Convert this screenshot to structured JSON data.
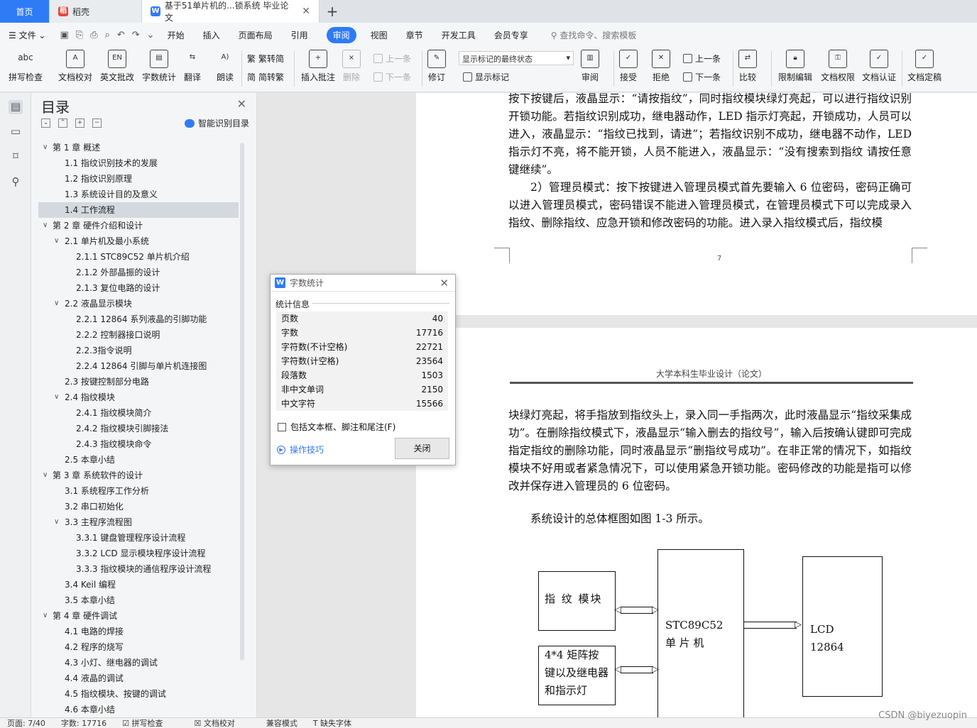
{
  "tabs": {
    "home": "首页",
    "daoke": "稻壳",
    "doc": "基于51单片机的...锁系统 毕业论文"
  },
  "menu": {
    "file": "文件",
    "items": [
      "开始",
      "插入",
      "页面布局",
      "引用",
      "审阅",
      "视图",
      "章节",
      "开发工具",
      "会员专享"
    ],
    "active": "审阅",
    "search": "查找命令、搜索模板"
  },
  "ribbon": {
    "spell": "拼写检查",
    "doccheck": "文档校对",
    "engcheck": "英文批改",
    "wordcount": "字数统计",
    "translate": "翻译",
    "read": "朗读",
    "trad": "繁转简",
    "simp": "简转繁",
    "insertcomment": "插入批注",
    "delete": "删除",
    "prev": "上一条",
    "next": "下一条",
    "revise": "修订",
    "markstate": "显示标记的最终状态",
    "showmark": "显示标记",
    "review": "审阅",
    "accept": "接受",
    "reject": "拒绝",
    "prev2": "上一条",
    "next2": "下一条",
    "compare": "比较",
    "restrict": "限制编辑",
    "rights": "文档权限",
    "auth": "文档认证",
    "final": "文档定稿"
  },
  "toc": {
    "title": "目录",
    "smart": "智能识别目录",
    "items": [
      {
        "t": "第 1 章  概述",
        "lv": 1,
        "arr": "﹀"
      },
      {
        "t": "1.1  指纹识别技术的发展",
        "lv": 2
      },
      {
        "t": "1.2  指纹识别原理",
        "lv": 2
      },
      {
        "t": "1.3  系统设计目的及意义",
        "lv": 2
      },
      {
        "t": "1.4  工作流程",
        "lv": 2,
        "sel": true
      },
      {
        "t": "第 2 章  硬件介绍和设计",
        "lv": 1,
        "arr": "﹀"
      },
      {
        "t": "2.1  单片机及最小系统",
        "lv": 2,
        "arr": "﹀"
      },
      {
        "t": "2.1.1 STC89C52 单片机介绍",
        "lv": 3
      },
      {
        "t": "2.1.2  外部晶振的设计",
        "lv": 3
      },
      {
        "t": "2.1.3  复位电路的设计",
        "lv": 3
      },
      {
        "t": "2.2  液晶显示模块",
        "lv": 2,
        "arr": "﹀"
      },
      {
        "t": "2.2.1 12864 系列液晶的引脚功能",
        "lv": 3
      },
      {
        "t": "2.2.2  控制器接口说明",
        "lv": 3
      },
      {
        "t": "2.2.3指令说明",
        "lv": 3
      },
      {
        "t": "2.2.4 12864 引脚与单片机连接图",
        "lv": 3
      },
      {
        "t": "2.3  按键控制部分电路",
        "lv": 2
      },
      {
        "t": "2.4  指纹模块",
        "lv": 2,
        "arr": "﹀"
      },
      {
        "t": "2.4.1  指纹模块简介",
        "lv": 3
      },
      {
        "t": "2.4.2  指纹模块引脚接法",
        "lv": 3
      },
      {
        "t": "2.4.3  指纹模块命令",
        "lv": 3
      },
      {
        "t": "2.5  本章小结",
        "lv": 2
      },
      {
        "t": "第 3 章  系统软件的设计",
        "lv": 1,
        "arr": "﹀"
      },
      {
        "t": "3.1  系统程序工作分析",
        "lv": 2
      },
      {
        "t": "3.2  串口初始化",
        "lv": 2
      },
      {
        "t": "3.3  主程序流程图",
        "lv": 2,
        "arr": "﹀"
      },
      {
        "t": "3.3.1  键盘管理程序设计流程",
        "lv": 3
      },
      {
        "t": "3.3.2 LCD 显示模块程序设计流程",
        "lv": 3
      },
      {
        "t": "3.3.3  指纹模块的通信程序设计流程",
        "lv": 3
      },
      {
        "t": "3.4 Keil 编程",
        "lv": 2
      },
      {
        "t": "3.5  本章小结",
        "lv": 2
      },
      {
        "t": "第 4 章  硬件调试",
        "lv": 1,
        "arr": "﹀"
      },
      {
        "t": "4.1  电路的焊接",
        "lv": 2
      },
      {
        "t": "4.2  程序的烧写",
        "lv": 2
      },
      {
        "t": "4.3  小灯、继电器的调试",
        "lv": 2
      },
      {
        "t": "4.4  液晶的调试",
        "lv": 2
      },
      {
        "t": "4.5  指纹模块、按键的调试",
        "lv": 2
      },
      {
        "t": "4.6  本章小结",
        "lv": 2
      }
    ]
  },
  "dialog": {
    "title": "字数统计",
    "section": "统计信息",
    "rows": [
      {
        "k": "页数",
        "v": "40"
      },
      {
        "k": "字数",
        "v": "17716"
      },
      {
        "k": "字符数(不计空格)",
        "v": "22721"
      },
      {
        "k": "字符数(计空格)",
        "v": "23564"
      },
      {
        "k": "段落数",
        "v": "1503"
      },
      {
        "k": "非中文单词",
        "v": "2150"
      },
      {
        "k": "中文字符",
        "v": "15566"
      }
    ],
    "checkbox": "包括文本框、脚注和尾注(F)",
    "tips": "操作技巧",
    "close": "关闭"
  },
  "page1": {
    "text": "按下按键后，液晶显示：“请按指纹”，同时指纹模块绿灯亮起，可以进行指纹识别开锁功能。若指纹识别成功，继电器动作，LED 指示灯亮起，开锁成功，人员可以进入，液晶显示：“指纹已找到，请进”；若指纹识别不成功，继电器不动作，LED 指示灯不亮，将不能开锁，人员不能进入，液晶显示：“没有搜索到指纹  请按任意键继续”。",
    "para2": "2）管理员模式：按下按键进入管理员模式首先要输入 6 位密码，密码正确可以进入管理员模式，密码错误不能进入管理员模式，在管理员模式下可以完成录入指纹、删除指纹、应急开锁和修改密码的功能。进入录入指纹模式后，指纹模",
    "pagenum": "7"
  },
  "page2": {
    "header": "大学本科生毕业设计（论文）",
    "text": "块绿灯亮起，将手指放到指纹头上，录入同一手指两次，此时液晶显示“指纹采集成功”。在删除指纹模式下，液晶显示“输入删去的指纹号”，输入后按确认键即可完成指定指纹的删除功能，同时液晶显示“删指纹号成功”。在非正常的情况下，如指纹模块不好用或者紧急情况下，可以使用紧急开锁功能。密码修改的功能是指可以修改并保存进入管理员的 6 位密码。",
    "caption": "系统设计的总体框图如图 1-3 所示。",
    "diagram": {
      "fp": "指  纹  模块",
      "mcu": "STC89C52\n单 片 机",
      "lcd": "LCD\n12864",
      "keys": "4*4 矩阵按键以及继电器和指示灯"
    }
  },
  "status": {
    "page": "页面: 7/40",
    "words": "字数: 17716",
    "spell": "拼写检查",
    "proof": "文档校对",
    "compat": "兼容模式",
    "font": "缺失字体"
  },
  "watermark": "CSDN @biyezuopin"
}
